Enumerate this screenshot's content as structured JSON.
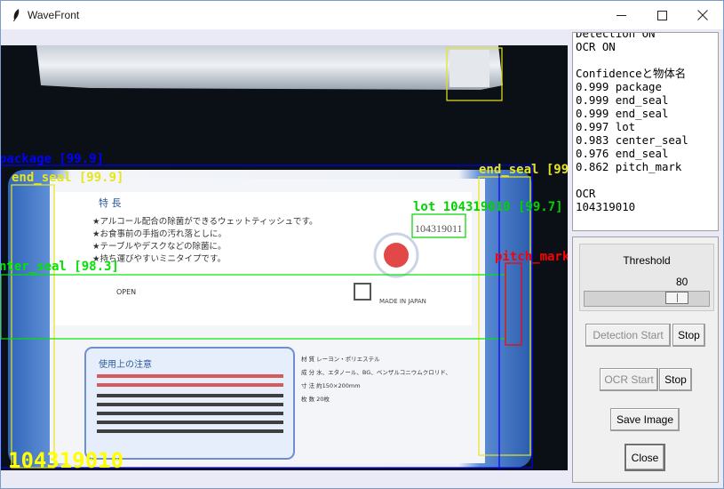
{
  "window": {
    "title": "WaveFront"
  },
  "camera": {
    "ocr_overlay": "104319010",
    "printed_lot": "104319011",
    "detections": [
      {
        "label": "package [99.9]",
        "color": "#0000ff"
      },
      {
        "label": "end_seal [99.9]",
        "color": "#e6e61e"
      },
      {
        "label": "end_seal [99",
        "color": "#e6e61e"
      },
      {
        "label": "lot 104319010 [99.7]",
        "color": "#00d200"
      },
      {
        "label": "pitch_mark",
        "color": "#ff0000"
      },
      {
        "label": "nter_seal [98.3]",
        "color": "#00e600"
      }
    ]
  },
  "log": {
    "lines": [
      "Detection ON",
      "OCR ON",
      "",
      "Confidenceと物体名",
      "0.999 package",
      "0.999 end_seal",
      "0.999 end_seal",
      "0.997 lot",
      "0.983 center_seal",
      "0.976 end_seal",
      "0.862 pitch_mark",
      "",
      "OCR",
      "104319010"
    ]
  },
  "controls": {
    "threshold_label": "Threshold",
    "threshold_value": 80,
    "detection_start_label": "Detection Start",
    "detection_stop_label": "Stop",
    "ocr_start_label": "OCR Start",
    "ocr_stop_label": "Stop",
    "save_image_label": "Save Image",
    "close_label": "Close"
  },
  "package_print": {
    "tokki": "特 長",
    "f1": "★アルコール配合の除菌ができるウェットティッシュです。",
    "f2": "★お食事前の手指の汚れ落としに。",
    "f3": "★テーブルやデスクなどの除菌に。",
    "f4": "★持ち運びやすいミニタイプです。",
    "open": "OPEN",
    "made_in": "MADE IN JAPAN",
    "notes_title": "使用上の注意",
    "spec1": "材 質 レーヨン・ポリエステル",
    "spec2": "成 分 水、エタノール、BG、ベンザルコニウムクロリド、",
    "spec3": "寸 法 約150×200mm",
    "spec4": "枚 数 20枚"
  }
}
